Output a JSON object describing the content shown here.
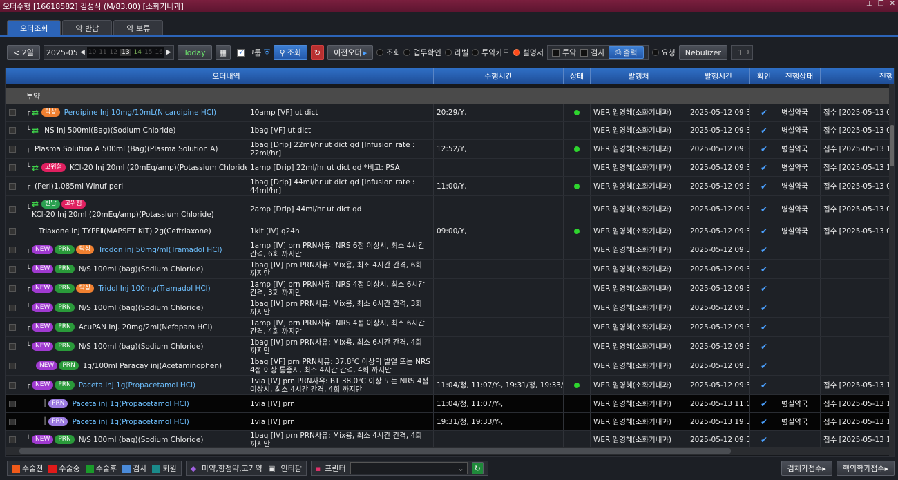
{
  "window": {
    "title": "오더수행 [16618582] 김성식 (M/83.00) [소화기내과]"
  },
  "tabs": [
    "오더조회",
    "약 반납",
    "약 보류"
  ],
  "toolbar": {
    "prev_label": "< 2일",
    "year_month": "2025-05",
    "days": [
      "10",
      "11",
      "12",
      "13",
      "14",
      "15",
      "16"
    ],
    "today_label": "Today",
    "group_label": "그룹",
    "search_label": "조회",
    "prev_order_label": "이전오더",
    "radios": [
      "조회",
      "업무확인",
      "라벨",
      "투약카드",
      "설명서"
    ],
    "chk_labels": [
      "투약",
      "검사"
    ],
    "print_label": "출력",
    "request_label": "요청",
    "nebulizer_label": "Nebulizer",
    "spinner_value": "1"
  },
  "grid": {
    "columns": [
      "오더내역",
      "수행시간",
      "상태",
      "발행처",
      "발행시간",
      "확인",
      "진행상태",
      "진행"
    ],
    "section_label": "투약",
    "rows": [
      {
        "badges": [
          {
            "t": "탁상",
            "c": "b-tak"
          }
        ],
        "swap": true,
        "tree": "┌",
        "name": "Perdipine Inj 10mg/10mL(Nicardipine HCl)",
        "link": true,
        "dose": "10amp  [VF] ut dict",
        "time": "20:29/Y,",
        "dot": true,
        "issuer": "WER 임영혜(소화기내과)",
        "issued": "2025-05-12 09:39",
        "state": "병실약국",
        "progress": "접수 [2025-05-13 0",
        "h": 26
      },
      {
        "badges": [],
        "swap": true,
        "tree": "└",
        "name": "NS Inj 500ml(Bag)(Sodium Chloride)",
        "link": false,
        "dose": "1bag  [VF] ut dict",
        "time": "",
        "dot": false,
        "issuer": "WER 임영혜(소화기내과)",
        "issued": "2025-05-12 09:39",
        "state": "병실약국",
        "progress": "접수 [2025-05-13 0",
        "h": 26
      },
      {
        "badges": [],
        "swap": false,
        "tree": "┌",
        "name": "Plasma Solution A 500ml (Bag)(Plasma Solution A)",
        "link": false,
        "dose": "1bag  [Drip] 22ml/hr  ut dict qd  [Infusion rate : 22ml/hr]",
        "time": "12:52/Y,",
        "dot": true,
        "issuer": "WER 임영혜(소화기내과)",
        "issued": "2025-05-12 09:39",
        "state": "병실약국",
        "progress": "접수 [2025-05-13 1",
        "h": 28
      },
      {
        "badges": [
          {
            "t": "고위험",
            "c": "b-high"
          }
        ],
        "swap": true,
        "tree": "└",
        "name": "KCl-20 Inj 20ml (20mEq/amp)(Potassium Chloride)",
        "link": false,
        "dose": "1amp  [Drip] 22ml/hr  ut dict qd *비고: PSA",
        "time": "",
        "dot": false,
        "issuer": "WER 임영혜(소화기내과)",
        "issued": "2025-05-12 09:39",
        "state": "병실약국",
        "progress": "접수 [2025-05-13 1",
        "h": 26
      },
      {
        "badges": [],
        "swap": false,
        "tree": "┌",
        "name": "(Peri)1,085ml Winuf peri",
        "link": false,
        "dose": "1bag  [Drip] 44ml/hr  ut dict qd  [Infusion rate : 44ml/hr]",
        "time": "11:00/Y,",
        "dot": true,
        "issuer": "WER 임영혜(소화기내과)",
        "issued": "2025-05-12 09:39",
        "state": "병실약국",
        "progress": "접수 [2025-05-13 0",
        "h": 28
      },
      {
        "badges": [
          {
            "t": "반납",
            "c": "b-ret"
          },
          {
            "t": "고위험",
            "c": "b-high"
          }
        ],
        "swap": true,
        "tree": "└",
        "name": "KCl-20 Inj 20ml (20mEq/amp)(Potassium Chloride)",
        "link": false,
        "dose": "2amp  [Drip] 44ml/hr  ut dict qd",
        "time": "",
        "dot": false,
        "issuer": "WER 임영혜(소화기내과)",
        "issued": "2025-05-12 09:39",
        "state": "병실약국",
        "progress": "접수 [2025-05-13 0",
        "h": 38,
        "twoline": true
      },
      {
        "badges": [],
        "swap": false,
        "tree": "",
        "name": "Triaxone inj TYPEⅡ(MAPSET KIT) 2g(Ceftriaxone)",
        "link": false,
        "dose": "1kit  [IV] q24h",
        "time": "09:00/Y,",
        "dot": true,
        "issuer": "WER 임영혜(소화기내과)",
        "issued": "2025-05-12 09:39",
        "state": "병실약국",
        "progress": "접수 [2025-05-13 0",
        "h": 26
      },
      {
        "badges": [
          {
            "t": "NEW",
            "c": "b-new"
          },
          {
            "t": "PRN",
            "c": "b-prn"
          },
          {
            "t": "탁상",
            "c": "b-tak"
          }
        ],
        "swap": false,
        "tree": "┌",
        "name": "Trodon inj 50mg/ml(Tramadol HCl)",
        "link": true,
        "dose": "1amp  [IV] prn PRN사유: NRS 6점 이상시, 최소 4시간 간격, 6회 까지만",
        "time": "",
        "dot": false,
        "issuer": "WER 임영혜(소화기내과)",
        "issued": "2025-05-12 09:39",
        "state": "",
        "progress": "",
        "h": 28
      },
      {
        "badges": [
          {
            "t": "NEW",
            "c": "b-new"
          },
          {
            "t": "PRN",
            "c": "b-prn"
          }
        ],
        "swap": false,
        "tree": "└",
        "name": "N/S 100ml (bag)(Sodium Chloride)",
        "link": false,
        "dose": "1bag  [IV] prn PRN사유: Mix용, 최소 4시간 간격, 6회 까지만",
        "time": "",
        "dot": false,
        "issuer": "WER 임영혜(소화기내과)",
        "issued": "2025-05-12 09:39",
        "state": "",
        "progress": "",
        "h": 28
      },
      {
        "badges": [
          {
            "t": "NEW",
            "c": "b-new"
          },
          {
            "t": "PRN",
            "c": "b-prn"
          },
          {
            "t": "탁상",
            "c": "b-tak"
          }
        ],
        "swap": false,
        "tree": "┌",
        "name": "Tridol Inj 100mg(Tramadol HCl)",
        "link": true,
        "dose": "1amp  [IV] prn PRN사유: NRS 4점 이상시, 최소 6시간 간격, 3회 까지만",
        "time": "",
        "dot": false,
        "issuer": "WER 임영혜(소화기내과)",
        "issued": "2025-05-12 09:39",
        "state": "",
        "progress": "",
        "h": 28
      },
      {
        "badges": [
          {
            "t": "NEW",
            "c": "b-new"
          },
          {
            "t": "PRN",
            "c": "b-prn"
          }
        ],
        "swap": false,
        "tree": "└",
        "name": "N/S 100ml (bag)(Sodium Chloride)",
        "link": false,
        "dose": "1bag  [IV] prn PRN사유: Mix용, 최소 6시간 간격, 3회 까지만",
        "time": "",
        "dot": false,
        "issuer": "WER 임영혜(소화기내과)",
        "issued": "2025-05-12 09:39",
        "state": "",
        "progress": "",
        "h": 28
      },
      {
        "badges": [
          {
            "t": "NEW",
            "c": "b-new"
          },
          {
            "t": "PRN",
            "c": "b-prn"
          }
        ],
        "swap": false,
        "tree": "┌",
        "name": "AcuPAN Inj. 20mg/2ml(Nefopam HCl)",
        "link": false,
        "dose": "1amp  [IV] prn PRN사유: NRS 4점 이상시, 최소 6시간 간격, 4회 까지만",
        "time": "",
        "dot": false,
        "issuer": "WER 임영혜(소화기내과)",
        "issued": "2025-05-12 09:39",
        "state": "",
        "progress": "",
        "h": 28
      },
      {
        "badges": [
          {
            "t": "NEW",
            "c": "b-new"
          },
          {
            "t": "PRN",
            "c": "b-prn"
          }
        ],
        "swap": false,
        "tree": "└",
        "name": "N/S 100ml (bag)(Sodium Chloride)",
        "link": false,
        "dose": "1bag  [IV] prn PRN사유: Mix용, 최소 6시간 간격, 4회 까지만",
        "time": "",
        "dot": false,
        "issuer": "WER 임영혜(소화기내과)",
        "issued": "2025-05-12 09:39",
        "state": "",
        "progress": "",
        "h": 28
      },
      {
        "badges": [
          {
            "t": "NEW",
            "c": "b-new"
          },
          {
            "t": "PRN",
            "c": "b-prn"
          }
        ],
        "swap": false,
        "tree": "",
        "name": "1g/100ml Paracay inj(Acetaminophen)",
        "link": false,
        "dose": "1bag  [VF] prn PRN사유: 37.8℃ 이상의 발열 또는 NRS 4점 이상 통증시, 최소 4시간 간격, 4회 까지만",
        "time": "",
        "dot": false,
        "issuer": "WER 임영혜(소화기내과)",
        "issued": "2025-05-12 09:39",
        "state": "",
        "progress": "",
        "h": 28
      },
      {
        "badges": [
          {
            "t": "NEW",
            "c": "b-new"
          },
          {
            "t": "PRN",
            "c": "b-prn"
          }
        ],
        "swap": false,
        "tree": "┌",
        "name": "Paceta inj 1g(Propacetamol HCl)",
        "link": true,
        "dose": "1via  [IV] prn PRN사유: BT 38.0℃ 이상 또는 NRS 4점 이상시, 최소 4시간 간격, 4회 까지만",
        "time": "11:04/청, 11:07/Y-, 19:31/청, 19:33/Y-,",
        "dot": true,
        "issuer": "WER 임영혜(소화기내과)",
        "issued": "2025-05-12 09:39",
        "state": "",
        "progress": "접수 [2025-05-13 1",
        "h": 28
      },
      {
        "badges": [
          {
            "t": "PRN",
            "c": "b-prn2"
          }
        ],
        "swap": false,
        "tree": "│",
        "name": "Paceta inj 1g(Propacetamol HCl)",
        "link": true,
        "dose": "1via  [IV] prn",
        "time": "11:04/청, 11:07/Y-,",
        "dot": false,
        "issuer": "WER 임영혜(소화기내과)",
        "issued": "2025-05-13 11:04",
        "state": "병실약국",
        "progress": "접수 [2025-05-13 1",
        "h": 26,
        "dark": true,
        "indent": true
      },
      {
        "badges": [
          {
            "t": "PRN",
            "c": "b-prn2"
          }
        ],
        "swap": false,
        "tree": "│",
        "name": "Paceta inj 1g(Propacetamol HCl)",
        "link": true,
        "dose": "1via  [IV] prn",
        "time": "19:31/청, 19:33/Y-,",
        "dot": false,
        "issuer": "WER 임영혜(소화기내과)",
        "issued": "2025-05-13 19:31",
        "state": "병실약국",
        "progress": "접수 [2025-05-13 1",
        "h": 26,
        "dark": true,
        "indent": true
      },
      {
        "badges": [
          {
            "t": "NEW",
            "c": "b-new"
          },
          {
            "t": "PRN",
            "c": "b-prn"
          }
        ],
        "swap": false,
        "tree": "└",
        "name": "N/S 100ml (bag)(Sodium Chloride)",
        "link": false,
        "dose": "1bag  [IV] prn PRN사유: Mix용, 최소 4시간 간격, 4회 까지만",
        "time": "",
        "dot": false,
        "issuer": "WER 임영혜(소화기내과)",
        "issued": "2025-05-12 09:39",
        "state": "",
        "progress": "접수 [2025-05-13 1",
        "h": 26
      }
    ]
  },
  "legend": {
    "items": [
      {
        "label": "수술전",
        "color": "#f05a1a"
      },
      {
        "label": "수술중",
        "color": "#e01a1a"
      },
      {
        "label": "수술후",
        "color": "#1a9a2a"
      },
      {
        "label": "검사",
        "color": "#4a8ad8"
      },
      {
        "label": "퇴원",
        "color": "#1a8a8a"
      }
    ],
    "drug_label": "마약,향정약,고가약",
    "intimap_label": "인티팜",
    "printer_label": "프린터",
    "btn_check": "검체가접수",
    "btn_nuclear": "핵의학가접수"
  }
}
